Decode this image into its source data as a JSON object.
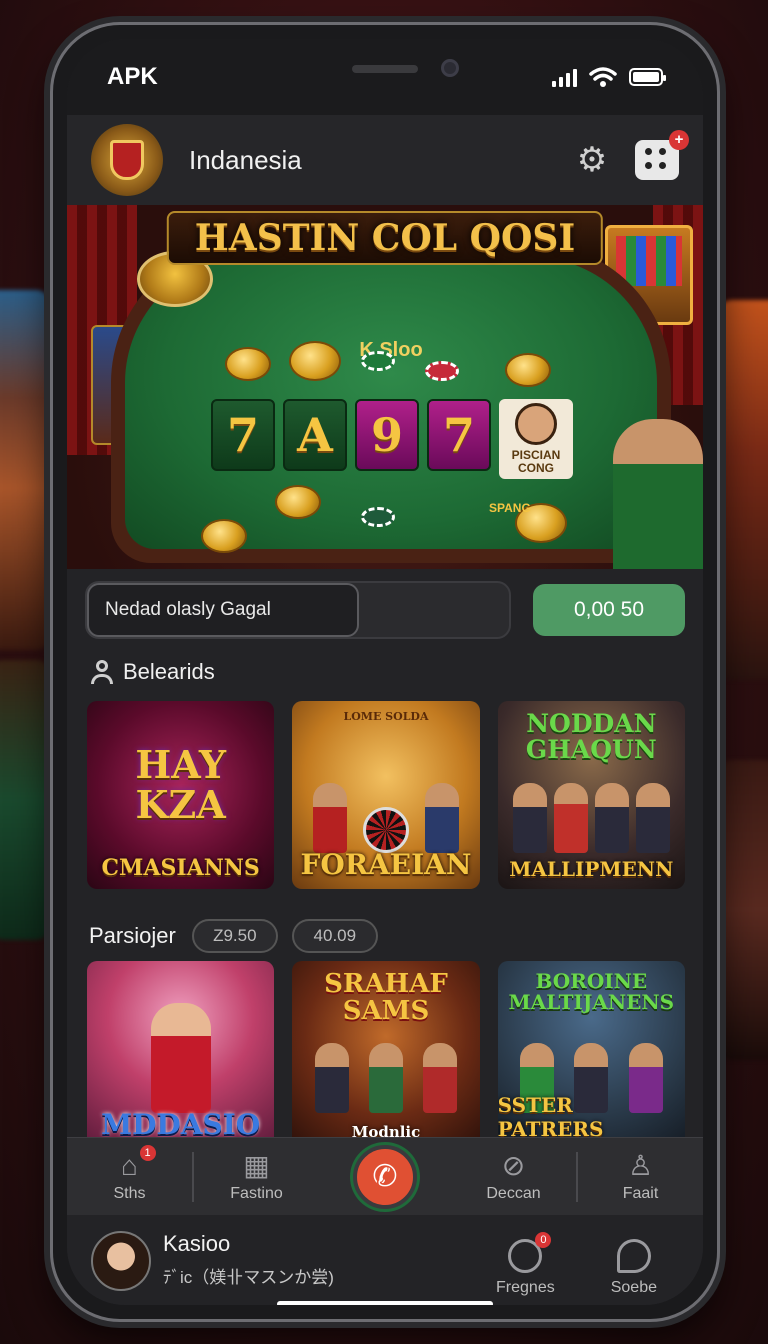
{
  "status_bar": {
    "carrier": "APK"
  },
  "header": {
    "title": "Indanesia",
    "dice_badge": "+"
  },
  "banner": {
    "title": "HASTIN COL QOSI",
    "felt_label": "K Sloo",
    "reels": [
      "7",
      "A",
      "9",
      "7"
    ],
    "reel_caption": "SPANG",
    "card_label": "PISCIAN CONG"
  },
  "search": {
    "value": "Nedad olasly Gagal",
    "amount_button": "0,00 50"
  },
  "section1": {
    "title": "Belearids",
    "tiles": [
      {
        "top": "HAY KZA",
        "bottom": "CMASIANNS"
      },
      {
        "top": "LOME SOLDA",
        "bottom": "FORAEIAN"
      },
      {
        "top": "NODDAN GHAQUN",
        "bottom": "MALLIPMENN"
      }
    ]
  },
  "section2": {
    "label": "Parsiojer",
    "pills": [
      "Z9.50",
      "40.09"
    ],
    "tiles": [
      {
        "top": "",
        "bottom": "MDDASIO"
      },
      {
        "top": "SRAHAF SAMS",
        "bottom": "Modnlic"
      },
      {
        "top": "BOROINE MALTIJANENS",
        "bottom": "SSTER PATRERS"
      }
    ]
  },
  "bottom_nav": {
    "items": [
      {
        "label": "Sths",
        "icon": "home-icon",
        "badge": "1"
      },
      {
        "label": "Fastino",
        "icon": "building-icon"
      },
      {
        "label": "Deccan",
        "icon": "blocked-icon"
      },
      {
        "label": "Faait",
        "icon": "user-icon"
      }
    ],
    "call_icon": "phone-icon"
  },
  "profile": {
    "name": "Kasioo",
    "subtitle": "ﾃﾞic（媄卝マスンか尝)",
    "actions": [
      {
        "label": "Fregnes",
        "icon": "compass-icon",
        "badge": "0"
      },
      {
        "label": "Soebe",
        "icon": "chat-icon"
      }
    ]
  },
  "colors": {
    "accent_green": "#4f9a64",
    "badge_red": "#d93535",
    "call_red": "#e05033",
    "gold": "#f5c542"
  }
}
